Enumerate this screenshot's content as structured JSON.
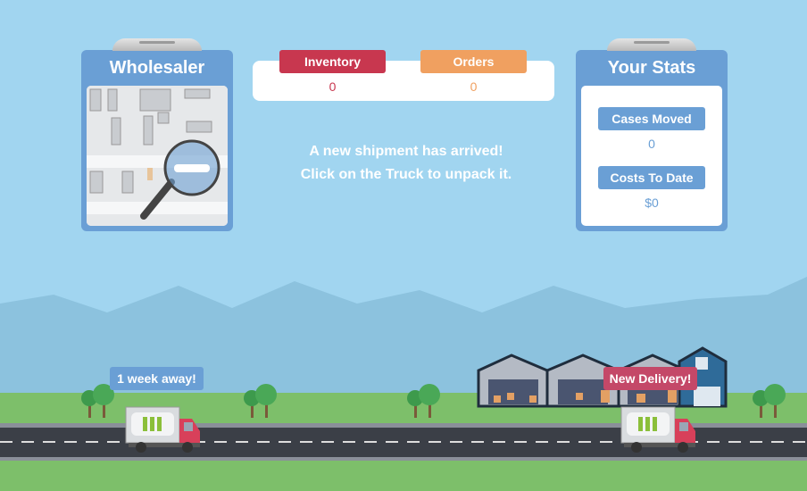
{
  "wholesaler": {
    "title": "Wholesaler"
  },
  "counters": {
    "inventory_label": "Inventory",
    "inventory_value": "0",
    "orders_label": "Orders",
    "orders_value": "0"
  },
  "message": {
    "line1": "A new shipment has arrived!",
    "line2": "Click on the Truck to unpack it."
  },
  "stats": {
    "title": "Your Stats",
    "cases_label": "Cases Moved",
    "cases_value": "0",
    "costs_label": "Costs To Date",
    "costs_value": "$0"
  },
  "tags": {
    "incoming": "1 week away!",
    "delivery": "New Delivery!"
  },
  "colors": {
    "sky": "#a1d5f0",
    "card": "#6a9fd5",
    "inventory": "#c8374f",
    "orders": "#f0a060",
    "delivery_tag": "#c44868",
    "grass": "#7dbf6a",
    "road": "#3b3f47"
  }
}
